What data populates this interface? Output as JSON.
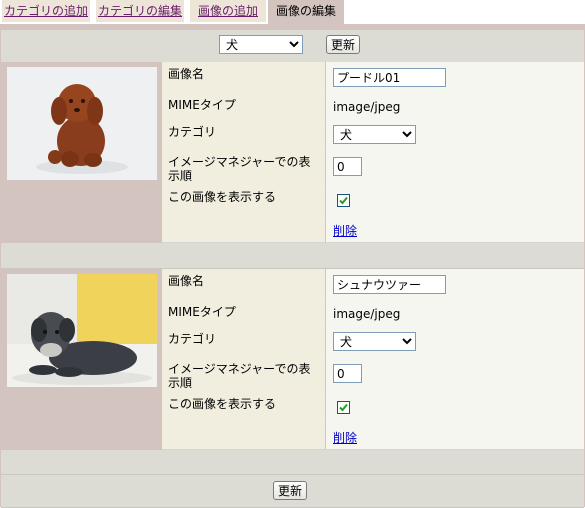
{
  "tabs": [
    {
      "label": "カテゴリの追加"
    },
    {
      "label": "カテゴリの編集"
    },
    {
      "label": "画像の追加"
    },
    {
      "label": "画像の編集"
    }
  ],
  "filter": {
    "selected": "犬",
    "update_label": "更新"
  },
  "images": [
    {
      "name_label": "画像名",
      "name_value": "プードル01",
      "mime_label": "MIMEタイプ",
      "mime_value": "image/jpeg",
      "category_label": "カテゴリ",
      "category_value": "犬",
      "order_label": "イメージマネジャーでの表示順",
      "order_value": "0",
      "display_label": "この画像を表示する",
      "display_checked": true,
      "delete_label": "削除"
    },
    {
      "name_label": "画像名",
      "name_value": "シュナウツァー",
      "mime_label": "MIMEタイプ",
      "mime_value": "image/jpeg",
      "category_label": "カテゴリ",
      "category_value": "犬",
      "order_label": "イメージマネジャーでの表示順",
      "order_value": "0",
      "display_label": "この画像を表示する",
      "display_checked": true,
      "delete_label": "削除"
    }
  ],
  "footer": {
    "update_label": "更新"
  }
}
